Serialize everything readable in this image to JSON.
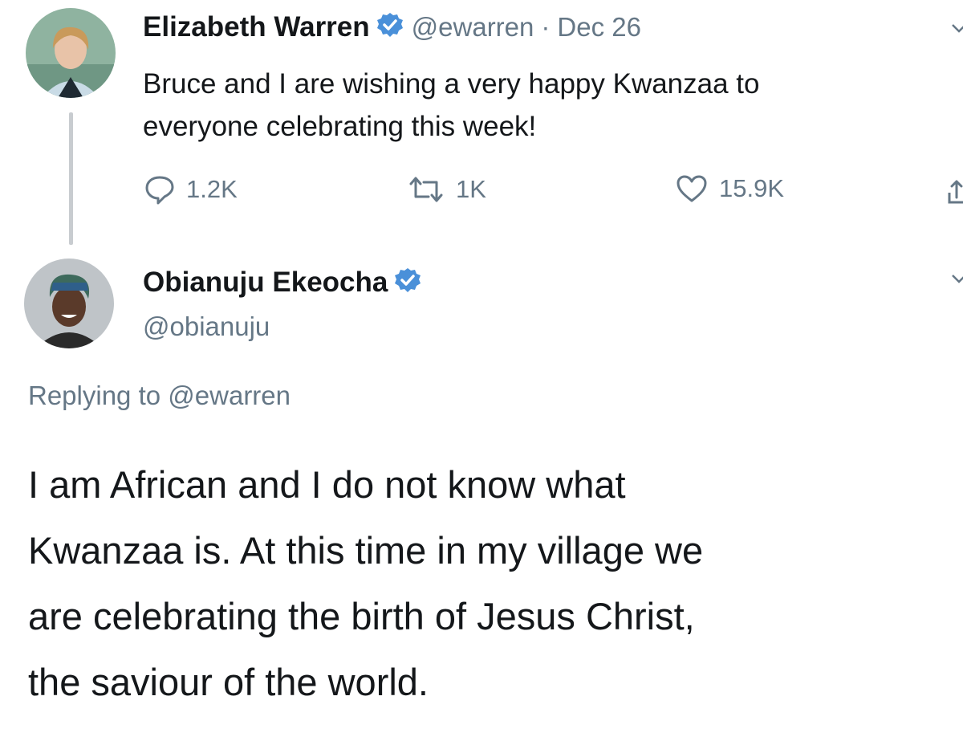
{
  "tweets": [
    {
      "author": {
        "name": "Elizabeth Warren",
        "handle": "@ewarren",
        "verified": true
      },
      "separator": "·",
      "date": "Dec 26",
      "text": "Bruce and I are wishing a very happy Kwanzaa to\neveryone celebrating this week!",
      "actions": {
        "replies": "1.2K",
        "retweets": "1K",
        "likes": "15.9K"
      },
      "icons": [
        "reply-icon",
        "retweet-icon",
        "like-icon",
        "share-icon",
        "chevron-down-icon"
      ]
    },
    {
      "author": {
        "name": "Obianuju Ekeocha",
        "handle": "@obianuju",
        "verified": true
      },
      "replying_prefix": "Replying to",
      "replying_to": "@ewarren",
      "text": "I am African and I do not know what\nKwanzaa is. At this time in my village we\nare celebrating the birth of Jesus Christ,\nthe saviour of the world.",
      "icons": [
        "chevron-down-icon"
      ]
    }
  ],
  "colors": {
    "verified_badge": "#4a90d9",
    "muted_text": "#657786",
    "primary_text": "#14171a",
    "thread_line": "#c8ccd0"
  }
}
